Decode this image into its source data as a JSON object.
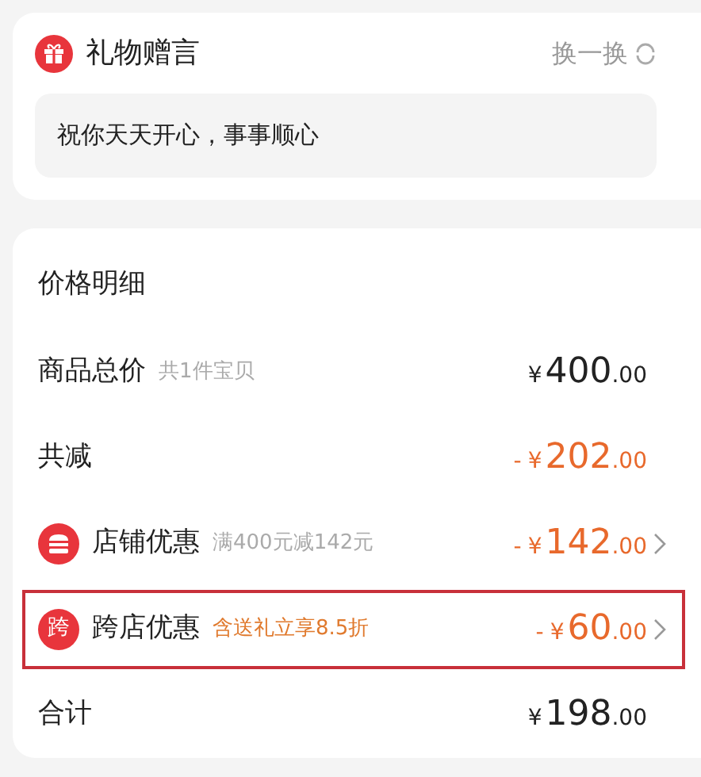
{
  "gift_message": {
    "title": "礼物赠言",
    "refresh_label": "换一换",
    "message": "祝你天天开心，事事顺心"
  },
  "price_detail": {
    "title": "价格明细",
    "rows": [
      {
        "kind": "plain",
        "label": "商品总价",
        "note": "共1件宝贝",
        "sign": "",
        "currency": "¥",
        "integer": "400",
        "decimals": ".00",
        "chevron": false,
        "highlighted": false
      },
      {
        "kind": "discount",
        "label": "共减",
        "sign": "-",
        "currency": "¥",
        "integer": "202",
        "decimals": ".00",
        "chevron": false,
        "highlighted": false
      },
      {
        "kind": "store",
        "label": "店铺优惠",
        "note": "满400元减142元",
        "note_accent": false,
        "sign": "-",
        "currency": "¥",
        "integer": "142",
        "decimals": ".00",
        "chevron": true,
        "highlighted": false
      },
      {
        "kind": "badge",
        "badge": "跨",
        "label": "跨店优惠",
        "note": "含送礼立享8.5折",
        "note_accent": true,
        "sign": "-",
        "currency": "¥",
        "integer": "60",
        "decimals": ".00",
        "chevron": true,
        "highlighted": true
      },
      {
        "kind": "plain",
        "label": "合计",
        "sign": "",
        "currency": "¥",
        "integer": "198",
        "decimals": ".00",
        "chevron": false,
        "highlighted": false
      }
    ]
  }
}
